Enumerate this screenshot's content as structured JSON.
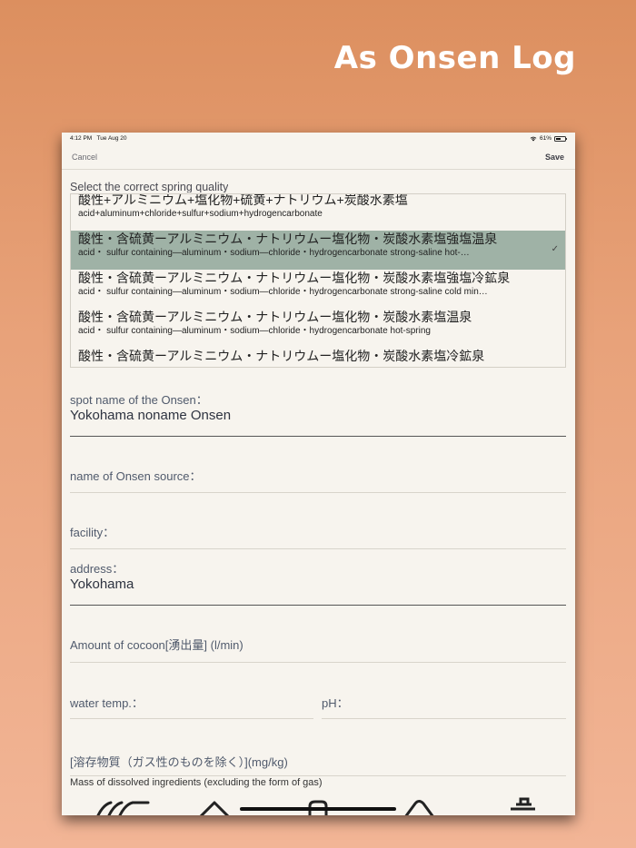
{
  "promo": {
    "title": "As Onsen Log"
  },
  "status_bar": {
    "time": "4:12 PM",
    "date": "Tue Aug 20",
    "battery": "61%",
    "battery_level": 0.61
  },
  "nav": {
    "cancel_label": "Cancel",
    "save_label": "Save"
  },
  "picker": {
    "label": "Select the correct spring quality",
    "selected_index": 1,
    "options": [
      {
        "jp": "酸性+アルミニウム+塩化物+硫黄+ナトリウム+炭酸水素塩",
        "en": "acid+aluminum+chloride+sulfur+sodium+hydrogencarbonate"
      },
      {
        "jp": "酸性・含硫黄ーアルミニウム・ナトリウムー塩化物・炭酸水素塩強塩温泉",
        "en": "acid・ sulfur containing—aluminum・sodium—chloride・hydrogencarbonate strong-saline hot-…"
      },
      {
        "jp": "酸性・含硫黄ーアルミニウム・ナトリウムー塩化物・炭酸水素塩強塩冷鉱泉",
        "en": "acid・ sulfur containing—aluminum・sodium—chloride・hydrogencarbonate strong-saline cold min…"
      },
      {
        "jp": "酸性・含硫黄ーアルミニウム・ナトリウムー塩化物・炭酸水素塩温泉",
        "en": "acid・ sulfur containing—aluminum・sodium—chloride・hydrogencarbonate hot-spring"
      },
      {
        "jp": "酸性・含硫黄ーアルミニウム・ナトリウムー塩化物・炭酸水素塩冷鉱泉",
        "en": ""
      }
    ]
  },
  "form": {
    "spot_name": {
      "label": "spot name of the Onsen：",
      "value": "Yokohama noname Onsen"
    },
    "source_name": {
      "label": "name of Onsen source：",
      "value": ""
    },
    "facility": {
      "label": "facility：",
      "value": ""
    },
    "address": {
      "label": "address：",
      "value": "Yokohama"
    },
    "amount": {
      "label": "Amount of cocoon[湧出量] (l/min)"
    },
    "water_temp": {
      "label": "water temp.："
    },
    "ph": {
      "label": "pH："
    },
    "dissolved": {
      "label": "[溶存物質（ガス性のものを除く）](mg/kg)",
      "sub": "Mass of dissolved ingredients (excluding the form of gas)"
    }
  },
  "tab_icons": [
    "onsen-icon",
    "mountain-icon",
    "bottle-icon",
    "volcano-icon",
    "bucket-icon"
  ]
}
